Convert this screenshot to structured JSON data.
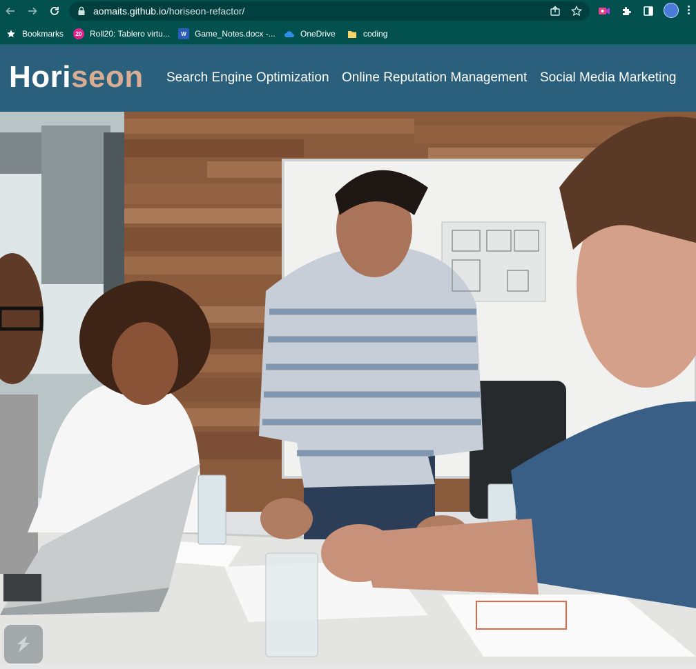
{
  "browser": {
    "url_host": "aomaits.github.io",
    "url_path": "/horiseon-refactor/",
    "icons": {
      "back": "arrow-left-icon",
      "forward": "arrow-right-icon",
      "reload": "reload-icon",
      "lock": "lock-icon",
      "share": "share-icon",
      "bookmark_star": "star-icon",
      "extension_1": "video-record-extension-icon",
      "extensions": "puzzle-icon",
      "side_panel": "side-panel-icon",
      "profile": "profile-avatar",
      "menu": "kebab-menu-icon"
    }
  },
  "bookmarks_bar": {
    "items": [
      {
        "label": "Bookmarks",
        "icon": "star-icon"
      },
      {
        "label": "Roll20: Tablero virtu...",
        "icon": "roll20-icon"
      },
      {
        "label": "Game_Notes.docx -...",
        "icon": "word-icon"
      },
      {
        "label": "OneDrive",
        "icon": "cloud-icon"
      },
      {
        "label": "coding",
        "icon": "folder-icon"
      }
    ]
  },
  "site": {
    "logo_main": "Hori",
    "logo_accent": "seon",
    "nav": [
      {
        "label": "Search Engine Optimization"
      },
      {
        "label": "Online Reputation Management"
      },
      {
        "label": "Social Media Marketing"
      }
    ]
  },
  "hero": {
    "image_name": "hero-image"
  },
  "colors": {
    "browser_bar": "#03514f",
    "header_bg": "#2a607c",
    "logo_accent": "#d9ad94",
    "nav_text": "#ffffff"
  }
}
